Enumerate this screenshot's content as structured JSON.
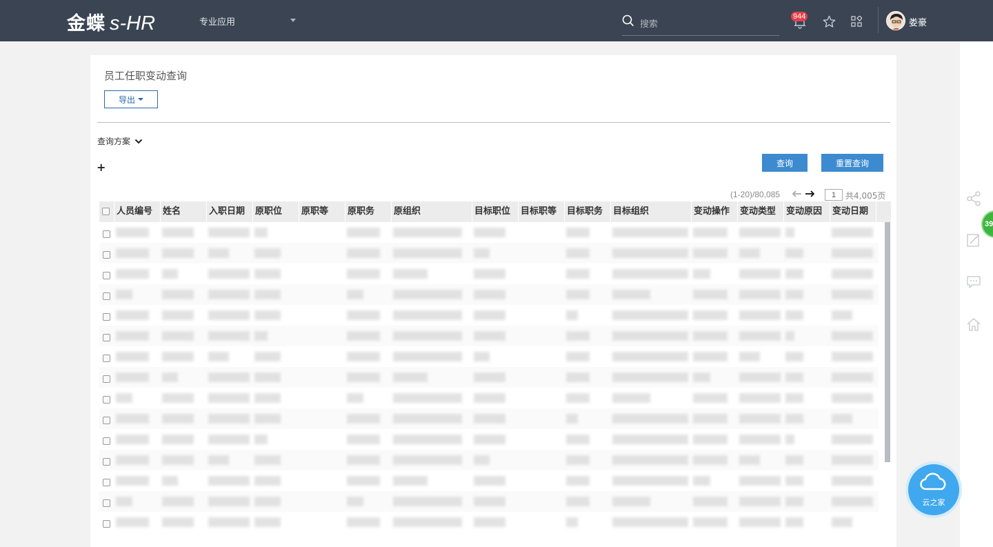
{
  "header": {
    "logo_cn": "金蝶",
    "logo_en": "s-HR",
    "app_menu": "专业应用",
    "search_placeholder": "搜索",
    "notification_count": "944",
    "username": "娄豪"
  },
  "page": {
    "title": "员工任职变动查询",
    "export_label": "导出",
    "query_scheme_label": "查询方案",
    "add_label": "+",
    "query_button": "查询",
    "reset_button": "重置查询"
  },
  "pager": {
    "range_text": "(1-20)/80,085",
    "current_page": "1",
    "total_text": "共4,005页"
  },
  "table": {
    "columns": [
      "人员编号",
      "姓名",
      "入职日期",
      "原职位",
      "原职等",
      "原职务",
      "原组织",
      "目标职位",
      "目标职等",
      "目标职务",
      "目标组织",
      "变动操作",
      "变动类型",
      "变动原因",
      "变动日期"
    ]
  },
  "side": {
    "cloud_label": "云之家",
    "green_badge": "39"
  },
  "colors": {
    "topbar": "#3a4453",
    "primary": "#3c8ad0",
    "cloud": "#3fa8ee"
  },
  "icons": [
    "search-icon",
    "bell-icon",
    "star-icon",
    "apps-grid-icon",
    "share-icon",
    "edit-icon",
    "chat-icon",
    "home-icon",
    "cloud-icon",
    "chevron-down-icon",
    "arrow-left-icon",
    "arrow-right-icon"
  ]
}
